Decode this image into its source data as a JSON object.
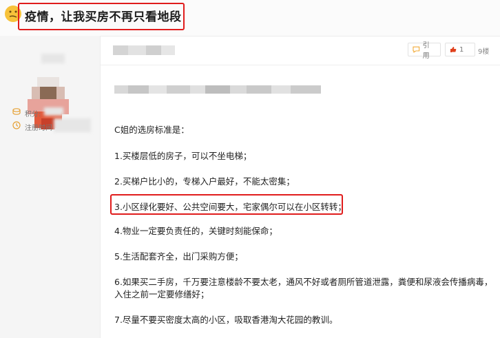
{
  "thread": {
    "title": "疫情，让我买房不再只看地段",
    "emoji": "thinking-face-icon"
  },
  "user": {
    "stats": [
      {
        "icon": "coin-icon",
        "label": "积分:"
      },
      {
        "icon": "clock-icon",
        "label": "注册时间"
      }
    ]
  },
  "post": {
    "quote_label": "引用",
    "like_count": "1",
    "floor": "9楼",
    "lines": [
      "C姐的选房标准是：",
      "1.买楼层低的房子，可以不坐电梯；",
      "2.买梯户比小的，专梯入户最好，不能太密集；",
      "3.小区绿化要好、公共空间要大，宅家偶尔可以在小区转转；",
      "4.物业一定要负责任的，关键时刻能保命；",
      "5.生活配套齐全，出门采购方便；",
      "6.如果买二手房，千万要注意楼龄不要太老，通风不好或者厕所管道泄露，粪便和尿液会传播病毒，",
      "入住之前一定要修缮好；",
      "7.尽量不要买密度太高的小区，吸取香港淘大花园的教训。"
    ]
  },
  "colors": {
    "highlight_red": "#e01b1b",
    "like_red": "#e0401c",
    "quote_orange": "#f0a020"
  }
}
